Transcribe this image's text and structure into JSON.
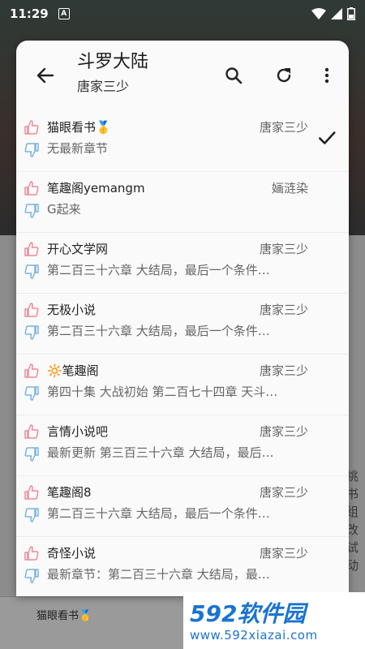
{
  "status_bar": {
    "time": "11:29",
    "notif_letter": "A"
  },
  "background": {
    "side_text": [
      "挑",
      "书",
      "组",
      "改",
      "试",
      "动"
    ],
    "bottom_label": "猫眼看书🥇"
  },
  "header": {
    "title": "斗罗大陆",
    "subtitle": "唐家三少"
  },
  "sources": [
    {
      "name": "猫眼看书🥇",
      "author": "唐家三少",
      "latest": "无最新章节",
      "selected": true
    },
    {
      "name": "笔趣阁yemangm",
      "author": "婳涟染",
      "latest": "G起来",
      "selected": false
    },
    {
      "name": "开心文学网",
      "author": "唐家三少",
      "latest": "第二百三十六章 大结局，最后一个条件…",
      "selected": false
    },
    {
      "name": "无极小说",
      "author": "唐家三少",
      "latest": "第二百三十六章 大结局，最后一个条件…",
      "selected": false
    },
    {
      "name": "🔆笔趣阁",
      "author": "唐家三少",
      "latest": "第四十集 大战初始 第二百七十四章 天斗…",
      "selected": false
    },
    {
      "name": "言情小说吧",
      "author": "唐家三少",
      "latest": "最新更新 第三百三十六章 大结局，最后…",
      "selected": false
    },
    {
      "name": "笔趣阁8",
      "author": "唐家三少",
      "latest": "第二百三十六章 大结局，最后一个条件…",
      "selected": false
    },
    {
      "name": "奇怪小说",
      "author": "唐家三少",
      "latest": "最新章节：第二百三十六章 大结局，最…",
      "selected": false
    }
  ],
  "watermark": {
    "digits": "592",
    "cn": "软件园",
    "url": "www.592xiazai.com"
  },
  "colors": {
    "vote_up": "#f08a99",
    "vote_down": "#7ab3e0",
    "accent": "#1a73d1"
  }
}
